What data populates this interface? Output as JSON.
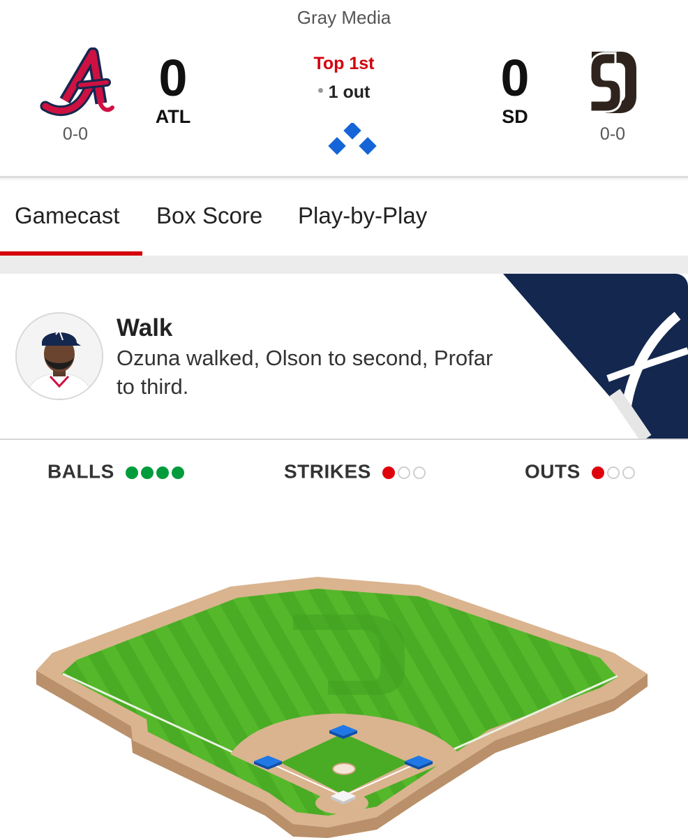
{
  "header": {
    "broadcast": "Gray Media",
    "away": {
      "record": "0-0",
      "score": "0",
      "abbr": "ATL",
      "logo_icon": "braves-a-logo-icon",
      "color": "#ce1141"
    },
    "home": {
      "record": "0-0",
      "score": "0",
      "abbr": "SD",
      "logo_icon": "padres-sd-logo-icon",
      "color": "#2f241d"
    },
    "inning": "Top 1st",
    "outs_text": "1 out",
    "bases": {
      "first": false,
      "second": false,
      "third": false,
      "icon": "bases-diamond-icon"
    }
  },
  "tabs": [
    {
      "label": "Gamecast",
      "active": true
    },
    {
      "label": "Box Score",
      "active": false
    },
    {
      "label": "Play-by-Play",
      "active": false
    }
  ],
  "play": {
    "title": "Walk",
    "description": "Ozuna walked, Olson to second, Profar to third.",
    "avatar_icon": "player-headshot-icon"
  },
  "count": {
    "balls": {
      "label": "BALLS",
      "value": 4,
      "max": 4
    },
    "strikes": {
      "label": "STRIKES",
      "value": 1,
      "max": 3
    },
    "outs": {
      "label": "OUTS",
      "value": 1,
      "max": 3
    }
  },
  "colors": {
    "accent_red": "#d3000c",
    "ball_green": "#009c3b",
    "strike_red": "#e0000b",
    "base_blue": "#1565d8",
    "navy": "#13274f"
  }
}
